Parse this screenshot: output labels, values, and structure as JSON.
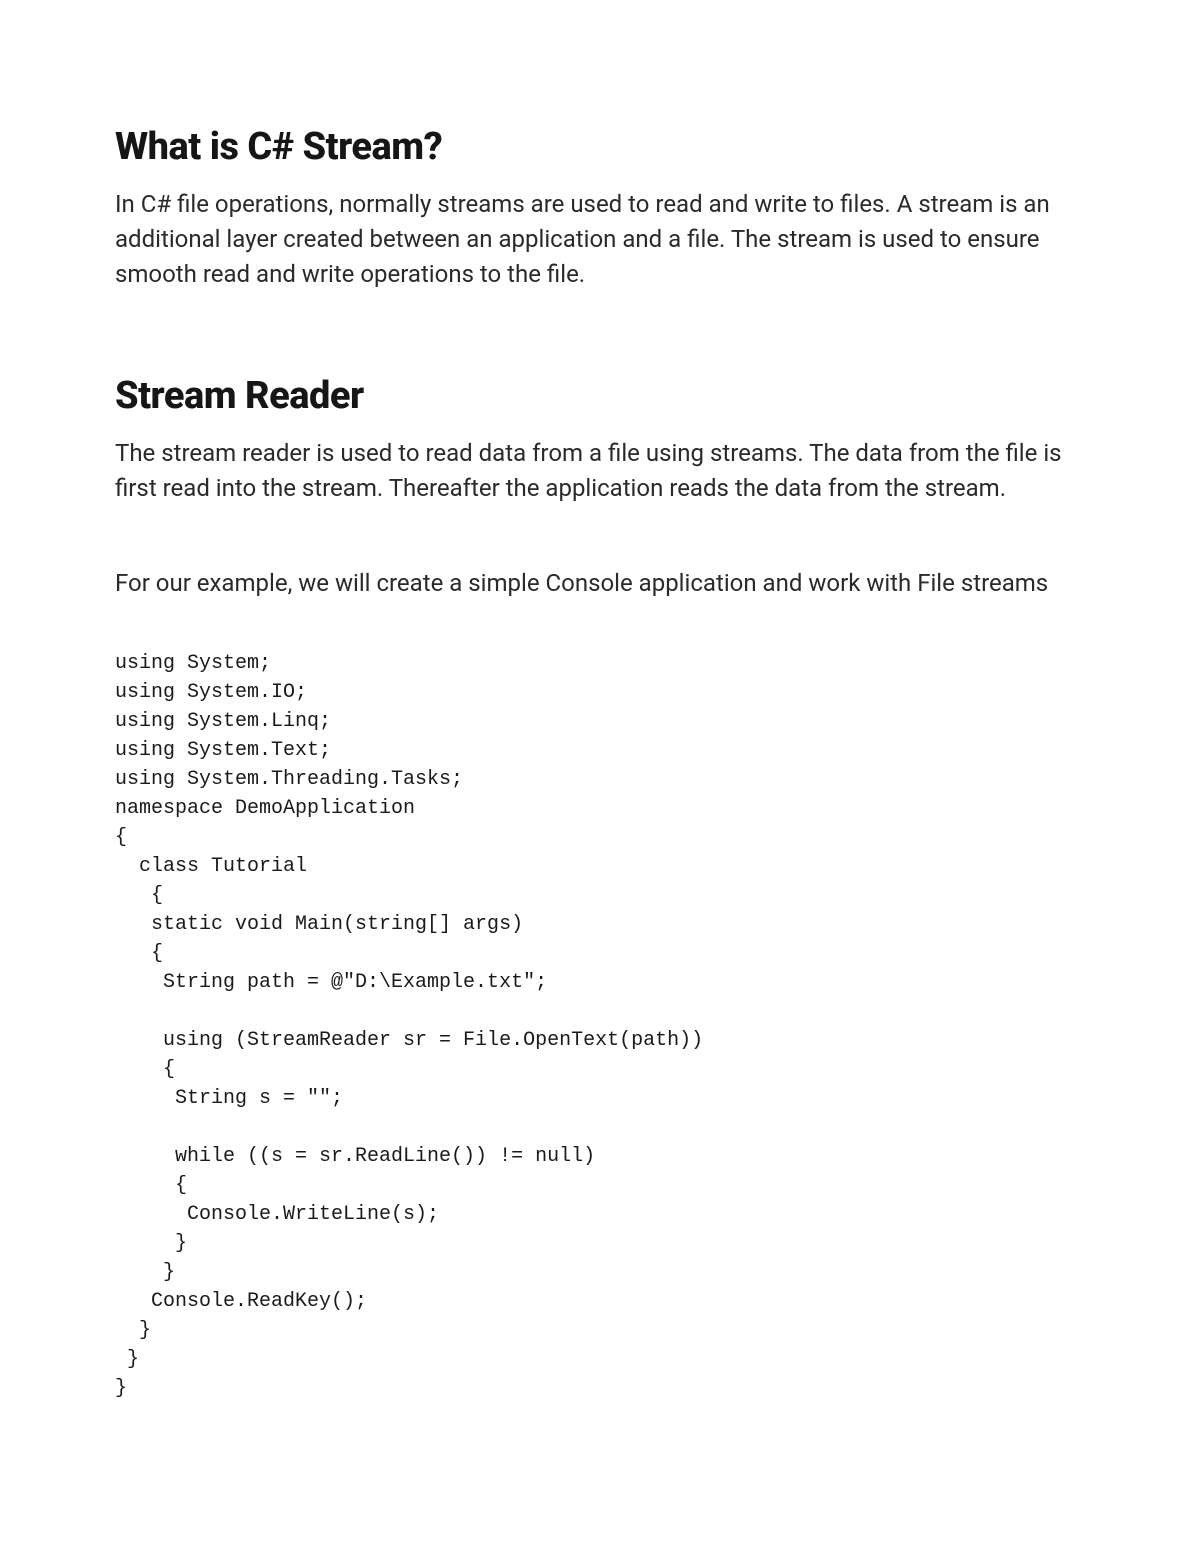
{
  "sections": {
    "s1": {
      "heading": "What is C# Stream?",
      "p1": "In C# file operations, normally streams are used to read and write to files. A stream is an additional layer created between an application and a file. The stream is used to ensure smooth read and write operations to the file."
    },
    "s2": {
      "heading": "Stream Reader",
      "p1": "The stream reader is used to read data from a file using streams. The data from the file is first read into the stream. Thereafter the application reads the data from the stream.",
      "p2": "For our example, we will create a simple Console application and work with File streams"
    }
  },
  "code": "using System;\nusing System.IO;\nusing System.Linq;\nusing System.Text;\nusing System.Threading.Tasks;\nnamespace DemoApplication\n{\n  class Tutorial\n   {\n   static void Main(string[] args)\n   {\n    String path = @\"D:\\Example.txt\";\n\n    using (StreamReader sr = File.OpenText(path))\n    {\n     String s = \"\";\n\n     while ((s = sr.ReadLine()) != null)\n     {\n      Console.WriteLine(s);\n     }\n    }\n   Console.ReadKey();\n  }\n }\n}"
}
